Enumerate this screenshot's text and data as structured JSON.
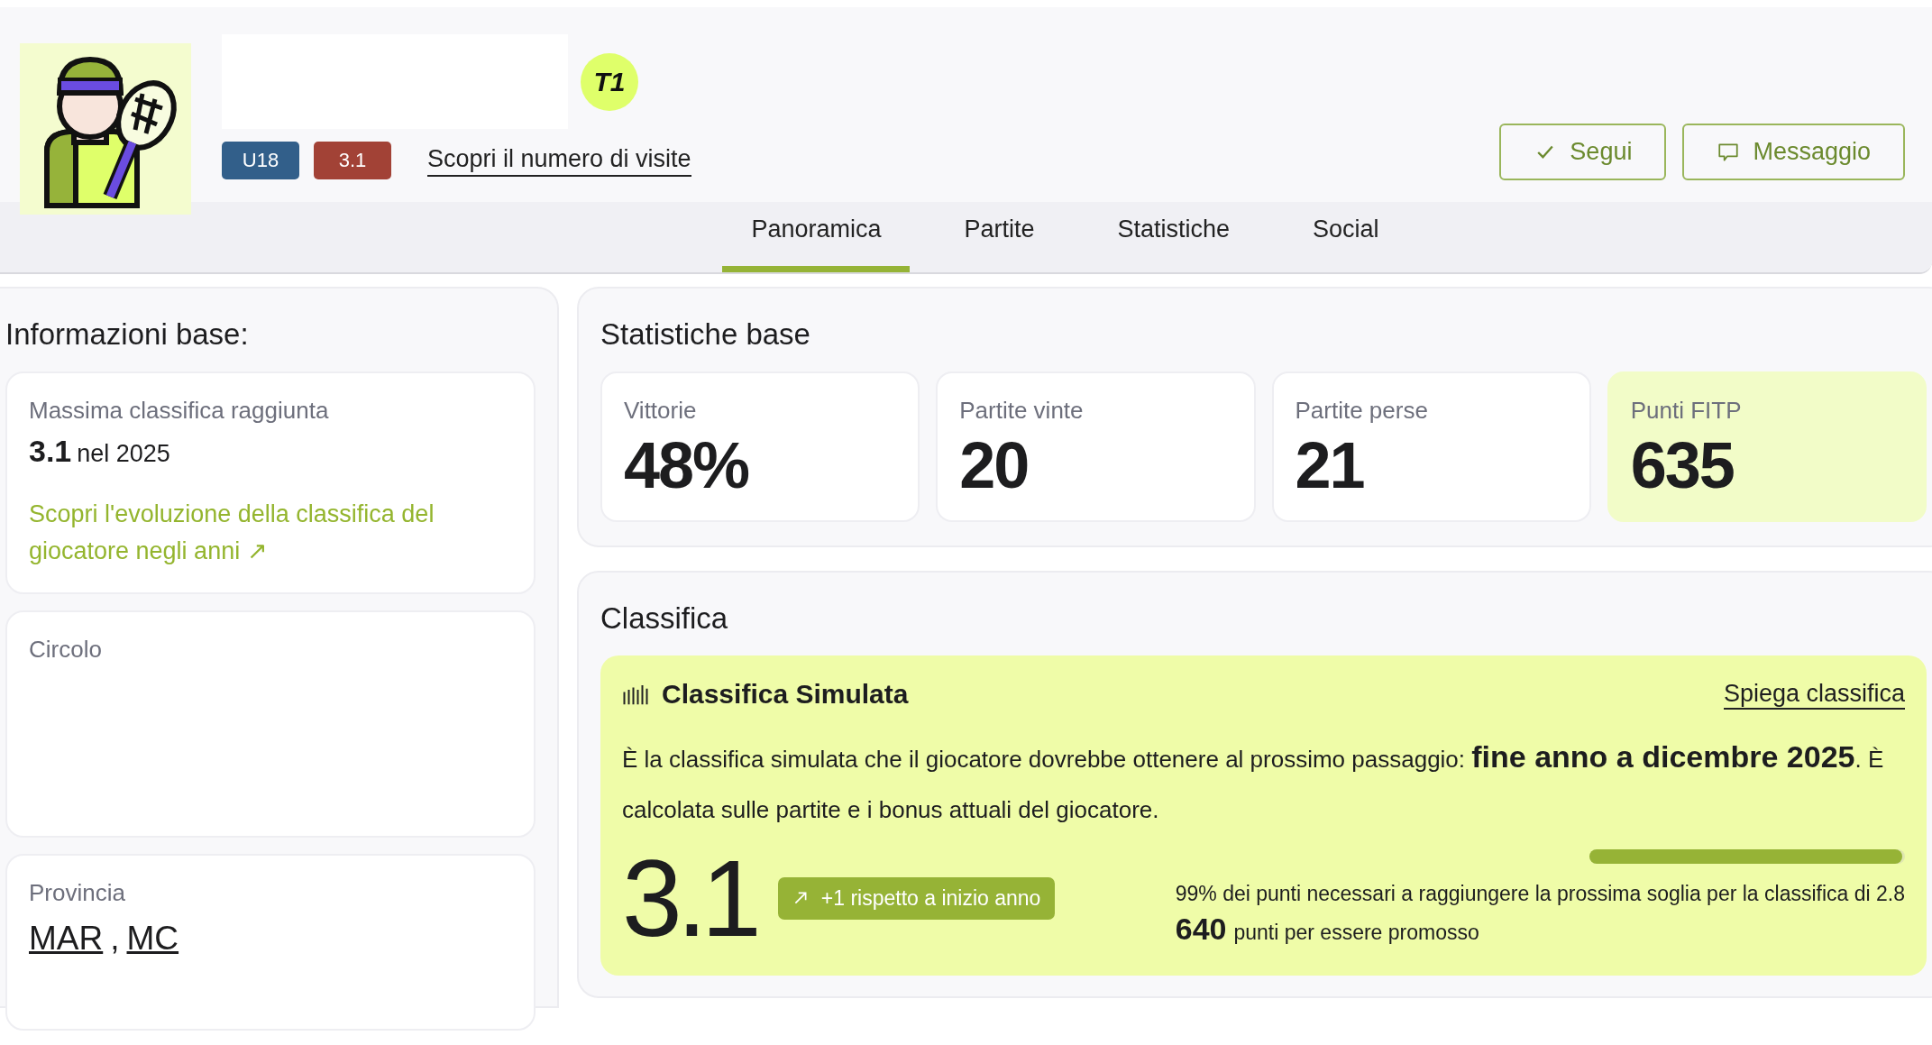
{
  "profile": {
    "logo_text": "T1",
    "badges": [
      {
        "label": "U18",
        "color": "#325f8a"
      },
      {
        "label": "3.1",
        "color": "#a24236"
      }
    ],
    "visits_link": "Scopri il numero di visite",
    "buttons": [
      {
        "label": "Segui",
        "kind": "follow"
      },
      {
        "label": "Messaggio",
        "kind": "message"
      }
    ]
  },
  "tabs": [
    {
      "label": "Panoramica",
      "selected": true
    },
    {
      "label": "Partite",
      "selected": false
    },
    {
      "label": "Statistiche",
      "selected": false
    },
    {
      "label": "Social",
      "selected": false
    }
  ],
  "basic_info": {
    "title": "Informazioni base:",
    "best_ranking": {
      "label": "Massima classifica raggiunta",
      "value": "3.1",
      "suffix": "nel 2025",
      "link": "Scopri l'evoluzione della classifica del giocatore negli anni ↗"
    },
    "club": {
      "label": "Circolo"
    },
    "province": {
      "label": "Provincia",
      "links": [
        "MAR",
        "MC"
      ],
      "separator": ","
    }
  },
  "stats": {
    "title": "Statistiche base",
    "cards": [
      {
        "label": "Vittorie",
        "value": "48%",
        "highlight": false
      },
      {
        "label": "Partite vinte",
        "value": "20",
        "highlight": false
      },
      {
        "label": "Partite perse",
        "value": "21",
        "highlight": false
      },
      {
        "label": "Punti FITP",
        "value": "635",
        "highlight": true
      }
    ]
  },
  "ranking": {
    "title": "Classifica",
    "simulated": {
      "title": "Classifica Simulata",
      "explain_link": "Spiega classifica",
      "description": "È la classifica simulata che il giocatore dovrebbe ottenere al prossimo passaggio: **fine anno a dicembre 2025**. È calcolata sulle partite e i bonus attuali del giocatore.",
      "value": "3.1",
      "change": "+1 rispetto a inizio anno",
      "level": 0.99,
      "progress_text": "99% dei punti necessari a raggiungere la prossima soglia per la classifica di 2.8",
      "points": "640",
      "points_text": "punti per essere promosso"
    }
  }
}
